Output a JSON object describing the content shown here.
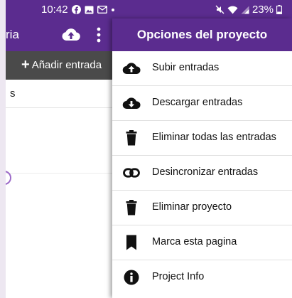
{
  "status_bar": {
    "time": "10:42",
    "battery": "23%",
    "notification_icons": [
      "facebook-icon",
      "gallery-icon",
      "mail-icon",
      "dot-icon"
    ],
    "system_icons": [
      "mute-icon",
      "wifi-icon",
      "signal-icon",
      "battery-icon"
    ]
  },
  "app": {
    "title_fragment": "ria",
    "add_entry_label": "Añadir entrada",
    "first_entry_fragment": "s"
  },
  "drawer": {
    "title": "Opciones del proyecto",
    "items": [
      {
        "label": "Subir entradas",
        "icon": "cloud-upload-icon"
      },
      {
        "label": "Descargar entradas",
        "icon": "cloud-download-icon"
      },
      {
        "label": "Eliminar todas las entradas",
        "icon": "trash-icon"
      },
      {
        "label": "Desincronizar entradas",
        "icon": "link-off-icon"
      },
      {
        "label": "Eliminar proyecto",
        "icon": "trash-icon"
      },
      {
        "label": "Marca esta pagina",
        "icon": "bookmark-icon"
      },
      {
        "label": "Project Info",
        "icon": "info-icon"
      }
    ]
  },
  "colors": {
    "primary": "#5b2c8f",
    "subbar": "#4a4a4a",
    "background": "#ede7f1"
  }
}
